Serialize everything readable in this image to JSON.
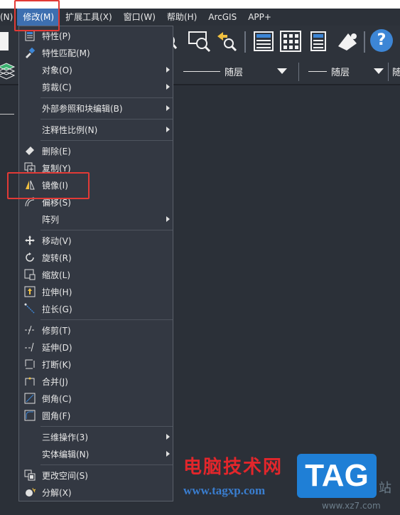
{
  "menubar": {
    "items": [
      {
        "label": "(N)"
      },
      {
        "label": "修改(M)"
      },
      {
        "label": "扩展工具(X)"
      },
      {
        "label": "窗口(W)"
      },
      {
        "label": "帮助(H)"
      },
      {
        "label": "ArcGIS"
      },
      {
        "label": "APP+"
      }
    ]
  },
  "toolbar": {
    "help_label": "?"
  },
  "properties": {
    "linetype_label": "随层",
    "lineweight_label": "随层",
    "last_label": "随"
  },
  "menu": {
    "items": [
      {
        "label": "特性(P)",
        "icon": "properties-icon"
      },
      {
        "label": "特性匹配(M)",
        "icon": "match-properties-icon"
      },
      {
        "label": "对象(O)"
      },
      {
        "label": "剪裁(C)"
      },
      {
        "label": "外部参照和块编辑(B)"
      },
      {
        "label": "注释性比例(N)"
      },
      {
        "label": "删除(E)",
        "icon": "eraser-icon"
      },
      {
        "label": "复制(Y)",
        "icon": "copy-icon"
      },
      {
        "label": "镜像(I)",
        "icon": "mirror-icon"
      },
      {
        "label": "偏移(S)",
        "icon": "offset-icon"
      },
      {
        "label": "阵列"
      },
      {
        "label": "移动(V)",
        "icon": "move-icon"
      },
      {
        "label": "旋转(R)",
        "icon": "rotate-icon"
      },
      {
        "label": "缩放(L)",
        "icon": "scale-icon"
      },
      {
        "label": "拉伸(H)",
        "icon": "stretch-icon"
      },
      {
        "label": "拉长(G)",
        "icon": "lengthen-icon"
      },
      {
        "label": "修剪(T)",
        "icon": "trim-icon"
      },
      {
        "label": "延伸(D)",
        "icon": "extend-icon"
      },
      {
        "label": "打断(K)",
        "icon": "break-icon"
      },
      {
        "label": "合并(J)",
        "icon": "join-icon"
      },
      {
        "label": "倒角(C)",
        "icon": "chamfer-icon"
      },
      {
        "label": "圆角(F)",
        "icon": "fillet-icon"
      },
      {
        "label": "三维操作(3)"
      },
      {
        "label": "实体编辑(N)"
      },
      {
        "label": "更改空间(S)",
        "icon": "change-space-icon"
      },
      {
        "label": "分解(X)",
        "icon": "explode-icon"
      }
    ]
  },
  "watermark": {
    "title": "电脑技术网",
    "url": "www.tagxp.com",
    "badge": "TAG",
    "side": "站",
    "small": "www.xz7.com"
  },
  "colors": {
    "highlight": "#e23a36",
    "menu_bg": "#333842",
    "accent": "#3d6fb0"
  }
}
